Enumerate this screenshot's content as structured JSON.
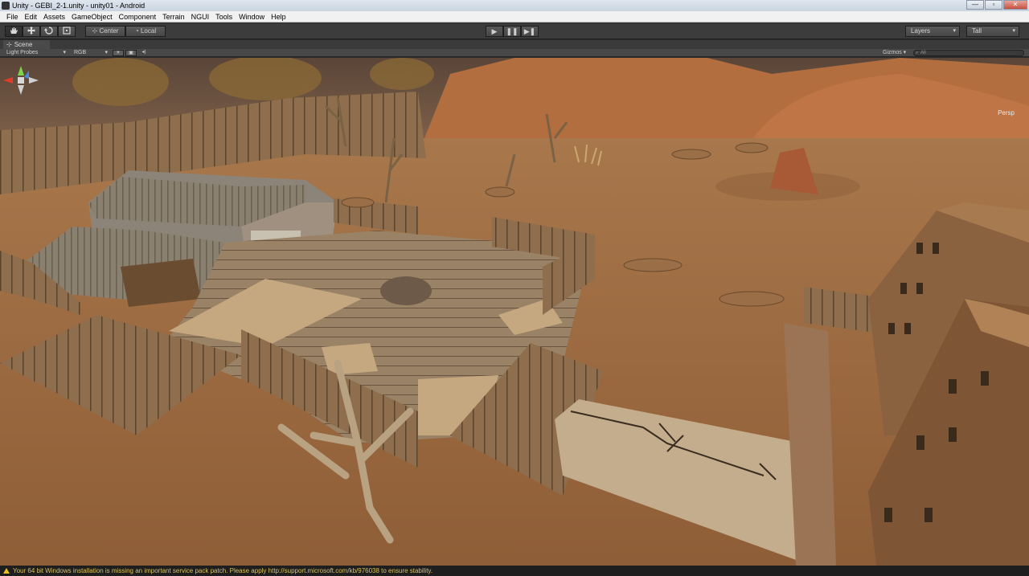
{
  "window": {
    "title": "Unity - GEBI_2-1.unity - unity01 - Android",
    "controls": [
      "—",
      "▫",
      "✕"
    ]
  },
  "menu": [
    "File",
    "Edit",
    "Assets",
    "GameObject",
    "Component",
    "Terrain",
    "NGUI",
    "Tools",
    "Window",
    "Help"
  ],
  "toolbar": {
    "tools": [
      "hand-icon",
      "move-icon",
      "rotate-icon",
      "scale-icon"
    ],
    "pivot_center": "Center",
    "pivot_local": "Local",
    "play_icons": [
      "▶",
      "❚❚",
      "▶❚"
    ],
    "layers": "Layers",
    "layout": "Tall"
  },
  "scene": {
    "tab": "Scene",
    "render_mode": "Light Probes",
    "color_mode": "RGB",
    "gizmos": "Gizmos",
    "search": "All",
    "persp_label": "Persp"
  },
  "status": {
    "message": "Your 64 bit Windows installation is missing an important service pack patch. Please apply http://support.microsoft.com/kb/976038 to ensure stability."
  }
}
